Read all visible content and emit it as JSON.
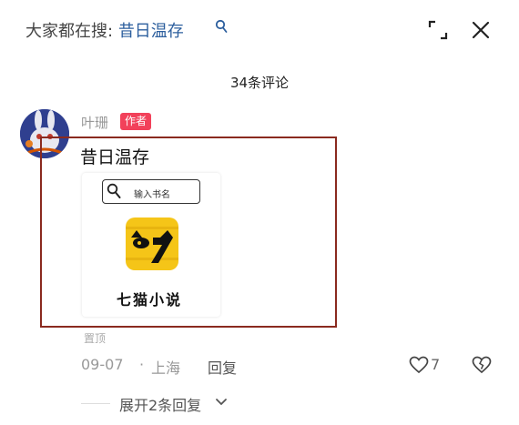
{
  "search": {
    "prefix": "大家都在搜:",
    "term": "昔日温存"
  },
  "comments": {
    "count_label": "34条评论"
  },
  "comment": {
    "username": "叶珊",
    "badge": "作者",
    "text": "昔日温存",
    "image": {
      "search_placeholder": "输入书名",
      "app_name": "七猫小说",
      "logo_color": "#f5c518"
    },
    "pinned_label": "置顶",
    "date": "09-07",
    "separator": "·",
    "location": "上海",
    "reply_label": "回复",
    "like_count": "7",
    "expand_replies_label": "展开2条回复"
  },
  "colors": {
    "search_term": "#2d5f9e",
    "badge_bg": "#f2415a",
    "highlight_border": "#8a2a1f"
  }
}
